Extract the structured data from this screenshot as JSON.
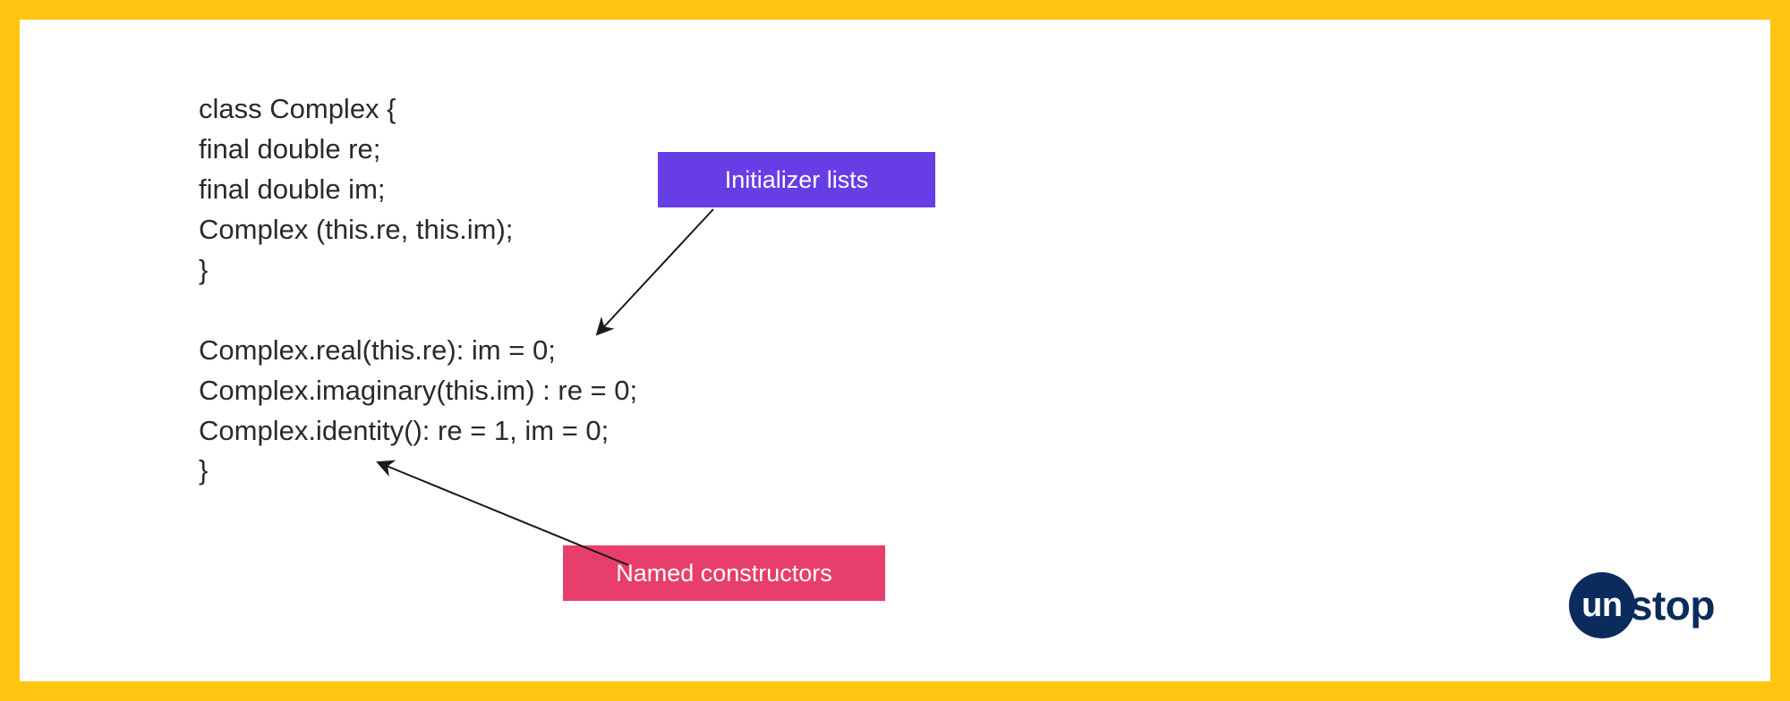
{
  "code": {
    "line1": "class Complex {",
    "line2": "final double re;",
    "line3": "final double im;",
    "line4": "Complex (this.re, this.im);",
    "line5": "}",
    "line6": "",
    "line7": "Complex.real(this.re): im = 0;",
    "line8": "Complex.imaginary(this.im) : re = 0;",
    "line9": "Complex.identity(): re = 1, im = 0;",
    "line10": "}"
  },
  "callouts": {
    "initializer": "Initializer lists",
    "named": "Named constructors"
  },
  "logo": {
    "circle": "un",
    "rest": "stop"
  },
  "colors": {
    "border": "#ffc511",
    "purple": "#673de6",
    "pink": "#e83e6b",
    "navy": "#0a2b5c"
  }
}
